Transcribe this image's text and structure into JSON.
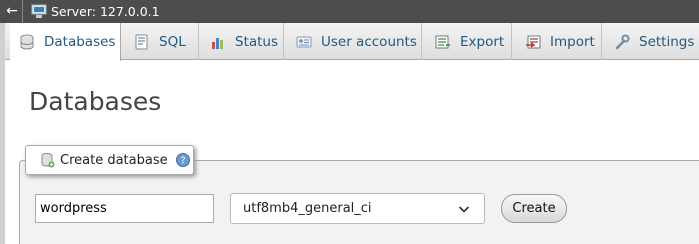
{
  "topbar": {
    "back_icon": "back-arrow-icon",
    "server_label": "Server: 127.0.0.1"
  },
  "tabs": [
    {
      "label": "Databases",
      "icon": "database-icon",
      "active": true
    },
    {
      "label": "SQL",
      "icon": "sql-icon"
    },
    {
      "label": "Status",
      "icon": "status-chart-icon"
    },
    {
      "label": "User accounts",
      "icon": "user-accounts-icon"
    },
    {
      "label": "Export",
      "icon": "export-icon"
    },
    {
      "label": "Import",
      "icon": "import-icon"
    },
    {
      "label": "Settings",
      "icon": "settings-wrench-icon"
    }
  ],
  "main": {
    "title": "Databases",
    "create": {
      "legend": "Create database",
      "db_name_value": "wordpress",
      "collation_selected": "utf8mb4_general_ci",
      "create_label": "Create"
    }
  },
  "colors": {
    "accent": "#235a81",
    "topbar": "#4d4d4d",
    "fieldset_bg": "#f2f2f2"
  }
}
